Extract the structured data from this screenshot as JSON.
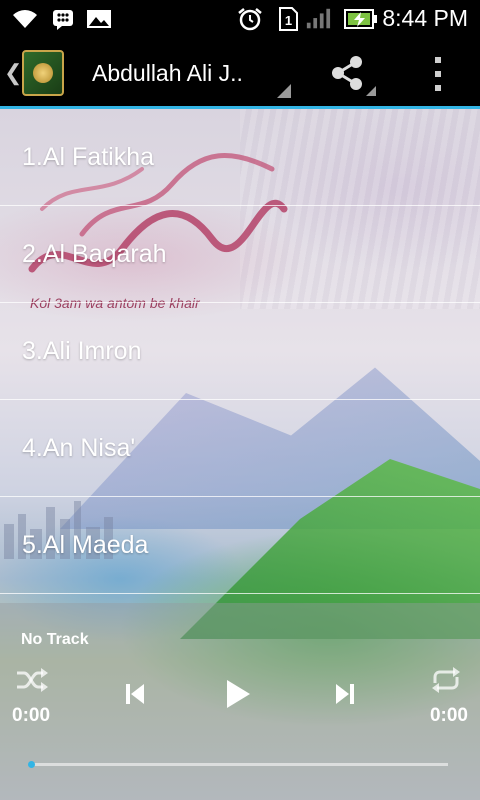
{
  "status_bar": {
    "time": "8:44 PM",
    "icons": [
      "wifi-icon",
      "bbm-icon",
      "gallery-icon",
      "alarm-icon",
      "sim-1-icon",
      "signal-icon",
      "battery-charging-icon"
    ],
    "sim_slot": "1"
  },
  "action_bar": {
    "title": "Abdullah Ali J..",
    "accent_color": "#33b5e5"
  },
  "background": {
    "tagline": "Kol 3am wa antom be khair"
  },
  "tracks": [
    {
      "label": "1.Al Fatikha"
    },
    {
      "label": "2.Al Baqarah"
    },
    {
      "label": "3.Ali Imron"
    },
    {
      "label": "4.An Nisa'"
    },
    {
      "label": "5.Al Maeda"
    }
  ],
  "player": {
    "now_playing": "No Track",
    "elapsed": "0:00",
    "duration": "0:00",
    "progress": 0.0
  }
}
